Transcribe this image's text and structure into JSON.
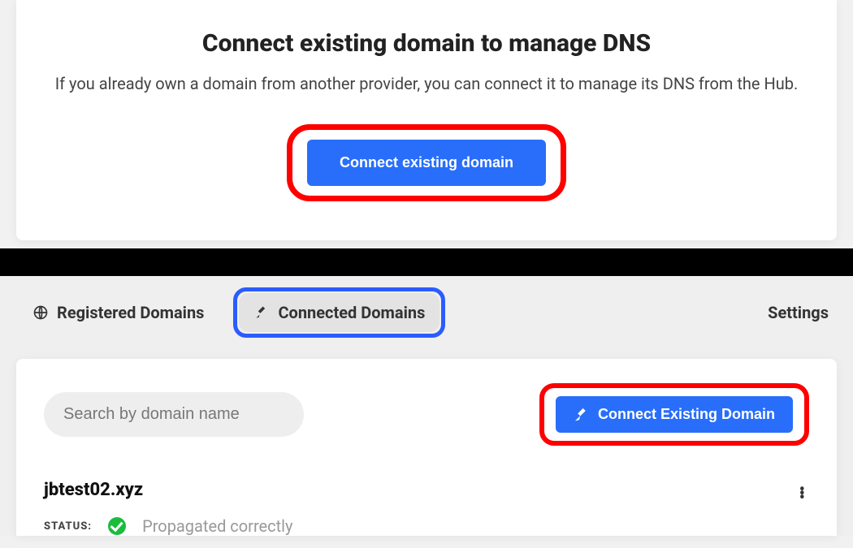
{
  "colors": {
    "primary": "#286efa",
    "annot_red": "#ff0000",
    "annot_blue": "#2a5cff",
    "status_ok": "#1abc3c"
  },
  "top": {
    "title": "Connect existing domain to manage DNS",
    "subtitle": "If you already own a domain from another provider, you can connect it to manage its DNS from the Hub.",
    "cta_label": "Connect existing domain"
  },
  "tabs": {
    "registered": {
      "label": "Registered Domains",
      "icon": "globe-icon"
    },
    "connected": {
      "label": "Connected Domains",
      "icon": "plug-icon"
    },
    "settings": {
      "label": "Settings"
    }
  },
  "search": {
    "placeholder": "Search by domain name",
    "value": ""
  },
  "connect_btn": {
    "label": "Connect Existing Domain",
    "icon": "plug-icon"
  },
  "domain": {
    "name": "jbtest02.xyz",
    "status_key": "STATUS:",
    "status_value": "Propagated correctly"
  }
}
